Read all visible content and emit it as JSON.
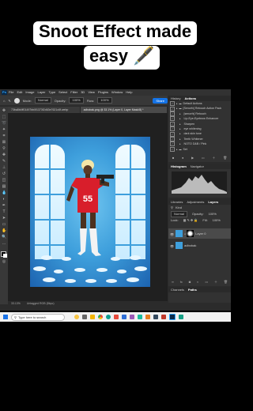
{
  "caption": {
    "line1": "Snoot Effect made",
    "line2": "easy",
    "emoji": "🖋️"
  },
  "menubar": {
    "items": [
      "File",
      "Edit",
      "Image",
      "Layer",
      "Type",
      "Select",
      "Filter",
      "3D",
      "View",
      "Plugins",
      "Window",
      "Help"
    ]
  },
  "options": {
    "mode_label": "Mode:",
    "mode_value": "Normal",
    "opacity_label": "Opacity:",
    "opacity_value": "100%",
    "flow_label": "Flow:",
    "flow_value": "100%",
    "share_label": "Share"
  },
  "document": {
    "tab_active": "adbobak.png @ 33.1% (Layer 0, Layer Mask/8) *",
    "tab_other": "73ba8b4ff01497bb0f1373f2d63e7621c6f.webp",
    "zoom": "33.13%",
    "size": "Untagged RGB (8bpc)"
  },
  "panels": {
    "history_tab": "History",
    "actions_tab": "Actions",
    "actions": [
      {
        "label": "Default Actions",
        "indent": 0
      },
      {
        "label": "[Senorfx] Retouch Action Pack",
        "indent": 0
      },
      {
        "label": "[senorfx] Retouch",
        "indent": 1
      },
      {
        "label": "Lip-Eye-Eyebrow Enhancer",
        "indent": 1
      },
      {
        "label": "Sharpen",
        "indent": 1
      },
      {
        "label": "eye whitening",
        "indent": 1
      },
      {
        "label": "dark skin tone",
        "indent": 1
      },
      {
        "label": "Teeth Whitener",
        "indent": 1
      },
      {
        "label": "NOTO D&B / Pink",
        "indent": 1
      },
      {
        "label": "Set",
        "indent": 0
      }
    ],
    "histogram_tab": "Histogram",
    "navigator_tab": "Navigator",
    "libraries_tab": "Libraries",
    "adjustments_tab": "Adjustments",
    "layers_tab": "Layers",
    "kind_label": "Kind",
    "blend_mode": "Normal",
    "opacity_label": "Opacity:",
    "opacity_value": "100%",
    "lock_label": "Lock:",
    "fill_label": "Fill:",
    "fill_value": "100%",
    "layers": [
      {
        "name": "Layer 0"
      },
      {
        "name": "adbobak"
      }
    ],
    "channels_tab": "Channels",
    "paths_tab": "Paths"
  },
  "taskbar": {
    "search_placeholder": "Type here to search"
  },
  "colors": {
    "accent": "#1473e6",
    "jersey": "#d81e2b",
    "background_blue": "#3e9fdc"
  }
}
